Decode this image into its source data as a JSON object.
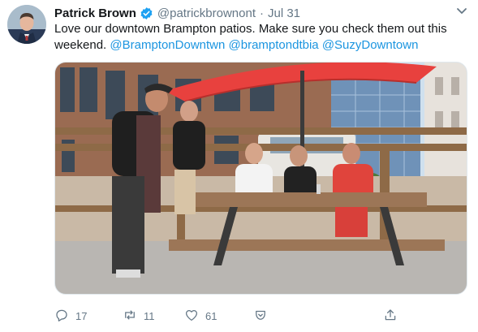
{
  "tweet": {
    "author_name": "Patrick Brown",
    "handle": "@patrickbrownont",
    "separator": "·",
    "date": "Jul 31",
    "text_line1": "Love our downtown Brampton patios.  Make sure you check them out this",
    "text_line2_prefix": "weekend.",
    "mentions": [
      "@BramptonDowntwn",
      "@bramptondtbia",
      "@SuzyDowntown"
    ]
  },
  "actions": {
    "replies": "17",
    "retweets": "11",
    "likes": "61"
  },
  "colors": {
    "accent": "#1b95e0",
    "secondary_text": "#657786",
    "verified": "#1da1f2",
    "umbrella": "#e8413e"
  },
  "icons": [
    "verified-icon",
    "chevron-down-icon",
    "reply-icon",
    "retweet-icon",
    "like-icon",
    "tip-jar-icon",
    "share-icon"
  ]
}
